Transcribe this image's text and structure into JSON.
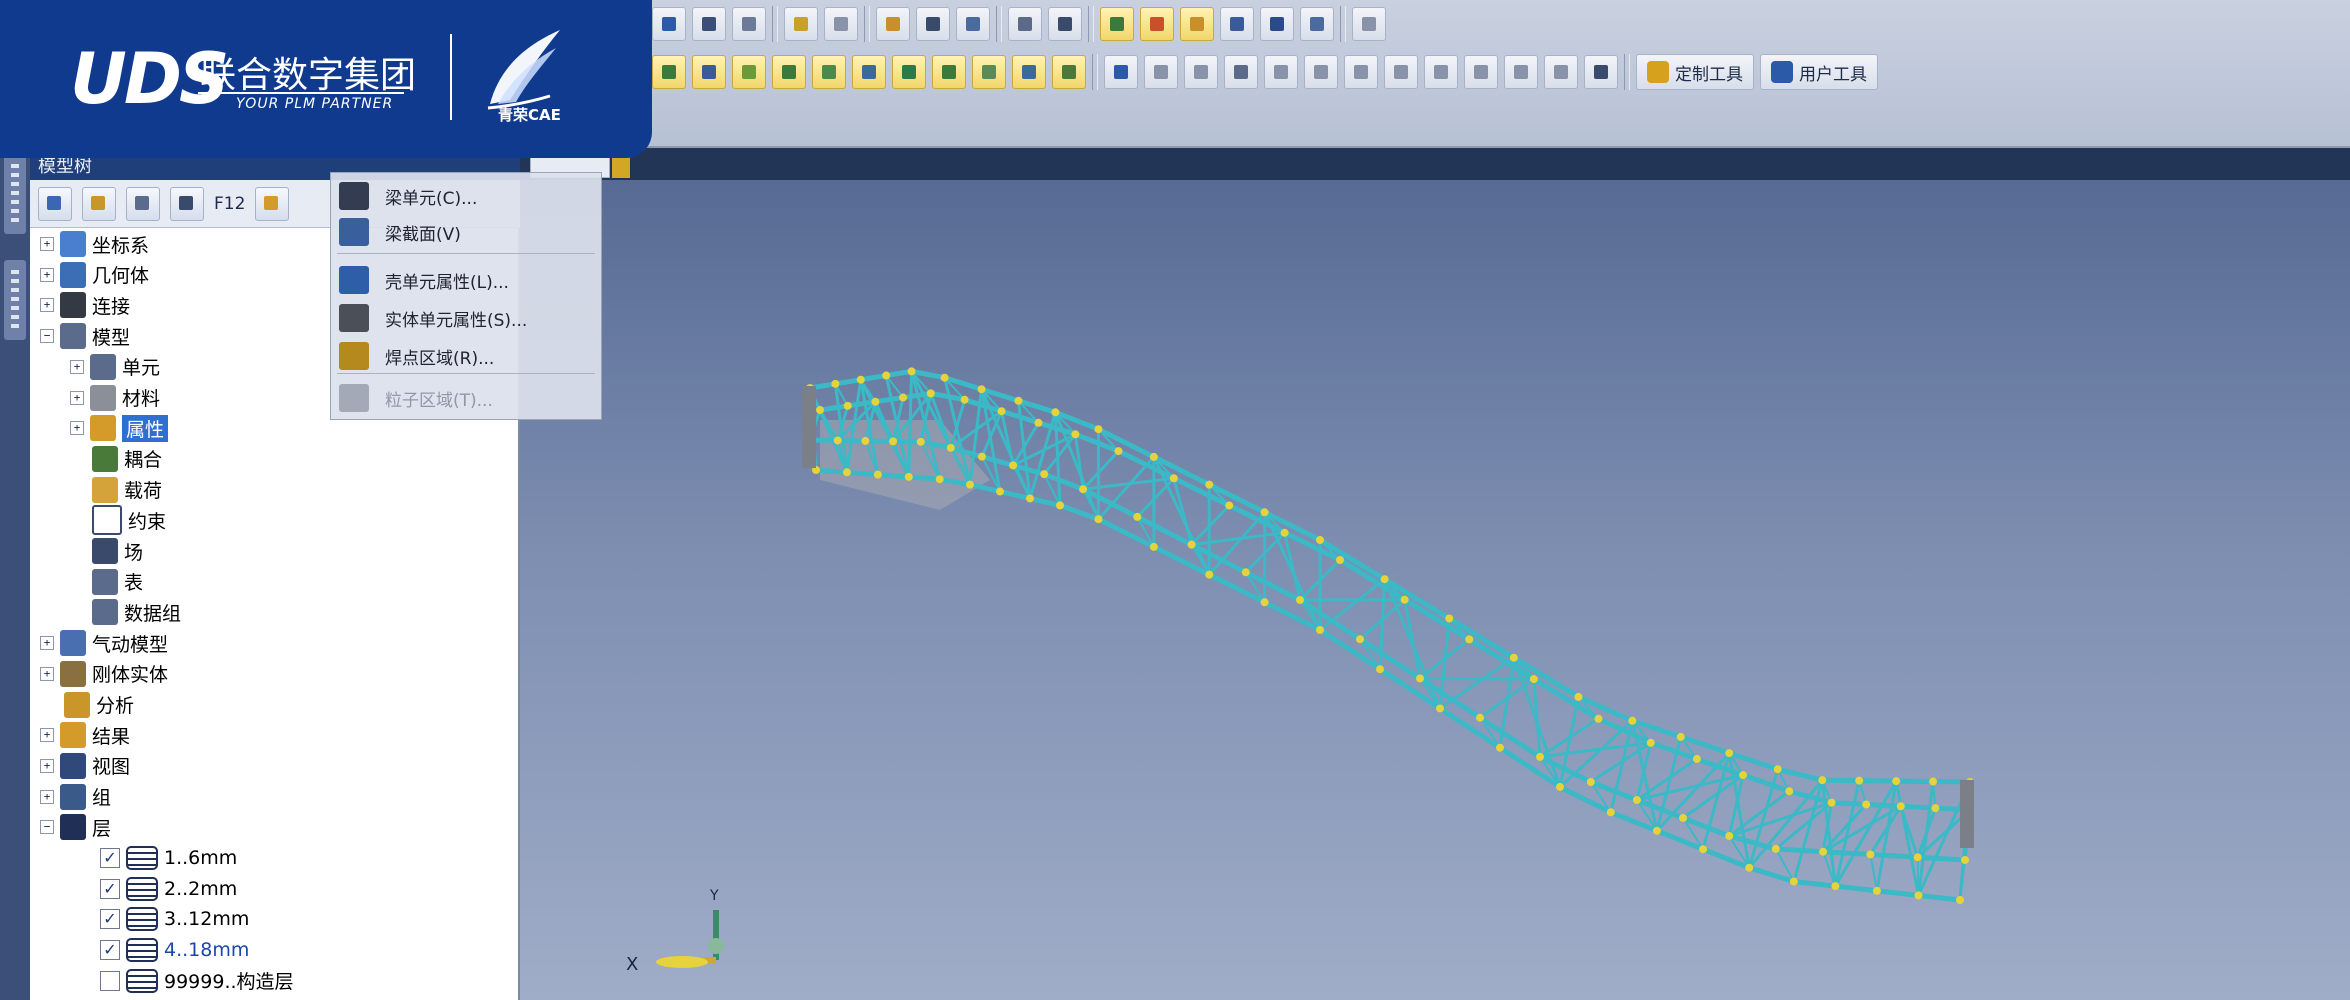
{
  "logo": {
    "brand": "UDS",
    "company_cn": "联合数字集团",
    "tagline": "YOUR PLM PARTNER",
    "product": "青荣CAE"
  },
  "panel": {
    "title": "模型树",
    "toolbar_filter_label": "F12"
  },
  "toolbar": {
    "custom_tools_label": "定制工具",
    "user_tools_label": "用户工具"
  },
  "tree": [
    {
      "label": "坐标系",
      "expander": "+",
      "icon_color": "#4a7fd0"
    },
    {
      "label": "几何体",
      "expander": "+",
      "icon_color": "#3b6eb4"
    },
    {
      "label": "连接",
      "expander": "+",
      "icon_color": "#333a44"
    },
    {
      "label": "模型",
      "expander": "−",
      "icon_color": "#5a6b8c"
    },
    {
      "label": "单元",
      "expander": "+",
      "icon_color": "#5a6b8c"
    },
    {
      "label": "材料",
      "expander": "+",
      "icon_color": "#8a8f98"
    },
    {
      "label": "属性",
      "expander": "+",
      "icon_color": "#d49b2a",
      "selected": true
    },
    {
      "label": "耦合",
      "icon_color": "#4a7a3a"
    },
    {
      "label": "载荷",
      "icon_color": "#d4a43a"
    },
    {
      "label": "约束",
      "icon_color": "#ffffff"
    },
    {
      "label": "场",
      "icon_color": "#3a4a6a"
    },
    {
      "label": "表",
      "icon_color": "#5a6b8c"
    },
    {
      "label": "数据组",
      "icon_color": "#5a6b8c"
    },
    {
      "label": "气动模型",
      "expander": "+",
      "icon_color": "#4a6fb0"
    },
    {
      "label": "刚体实体",
      "expander": "+",
      "icon_color": "#8a7040"
    },
    {
      "label": "分析",
      "icon_color": "#c9962a"
    },
    {
      "label": "结果",
      "expander": "+",
      "icon_color": "#d49b2a"
    },
    {
      "label": "视图",
      "expander": "+",
      "icon_color": "#2f4a7a"
    },
    {
      "label": "组",
      "expander": "+",
      "icon_color": "#3a5a8a"
    },
    {
      "label": "层",
      "expander": "−",
      "icon_color": "#1f2f56"
    }
  ],
  "layers": [
    {
      "label": "1..6mm",
      "checked": true
    },
    {
      "label": "2..2mm",
      "checked": true
    },
    {
      "label": "3..12mm",
      "checked": true
    },
    {
      "label": "4..18mm",
      "checked": true,
      "highlight": true
    },
    {
      "label": "99999..构造层",
      "checked": false
    }
  ],
  "dropdown": {
    "items": [
      {
        "label": "梁单元(C)...",
        "icon_color": "#333c50"
      },
      {
        "label": "梁截面(V)",
        "icon_color": "#3a5f9d"
      },
      {
        "label": "壳单元属性(L)...",
        "icon_color": "#2e5ea8"
      },
      {
        "label": "实体单元属性(S)...",
        "icon_color": "#4a4f58"
      },
      {
        "label": "焊点区域(R)...",
        "icon_color": "#b5891e"
      },
      {
        "label": "粒子区域(T)...",
        "icon_color": "#8e94a0",
        "disabled": true
      }
    ]
  },
  "triad": {
    "x_label": "X",
    "y_label": "Y"
  },
  "colors": {
    "truss_member": "#3bb9c6",
    "truss_node": "#e6d23a",
    "end_plate": "#7a7f88",
    "logo_bg": "#0f3a8e"
  }
}
